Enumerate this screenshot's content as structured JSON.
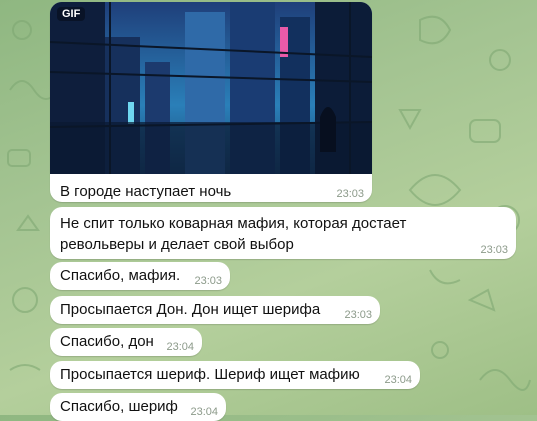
{
  "chat": {
    "media_message": {
      "badge": "GIF",
      "caption": "В городе наступает ночь",
      "time": "23:03"
    },
    "messages": [
      {
        "line1": "Не спит только коварная мафия, которая достает",
        "line2": "револьверы и делает свой выбор",
        "time": "23:03"
      },
      {
        "text": "Спасибо, мафия.",
        "time": "23:03"
      },
      {
        "text": "Просыпается Дон. Дон ищет шерифа",
        "time": "23:03"
      },
      {
        "text": "Спасибо, дон",
        "time": "23:04"
      },
      {
        "text": "Просыпается шериф. Шериф ищет мафию",
        "time": "23:04"
      },
      {
        "text": "Спасибо, шериф",
        "time": "23:04"
      }
    ]
  },
  "colors": {
    "bubble": "#ffffff",
    "timestamp": "#8c9a8a",
    "wallpaper": "#a4c492"
  },
  "icons": [
    "gif-badge",
    "wallpaper-doodles"
  ]
}
